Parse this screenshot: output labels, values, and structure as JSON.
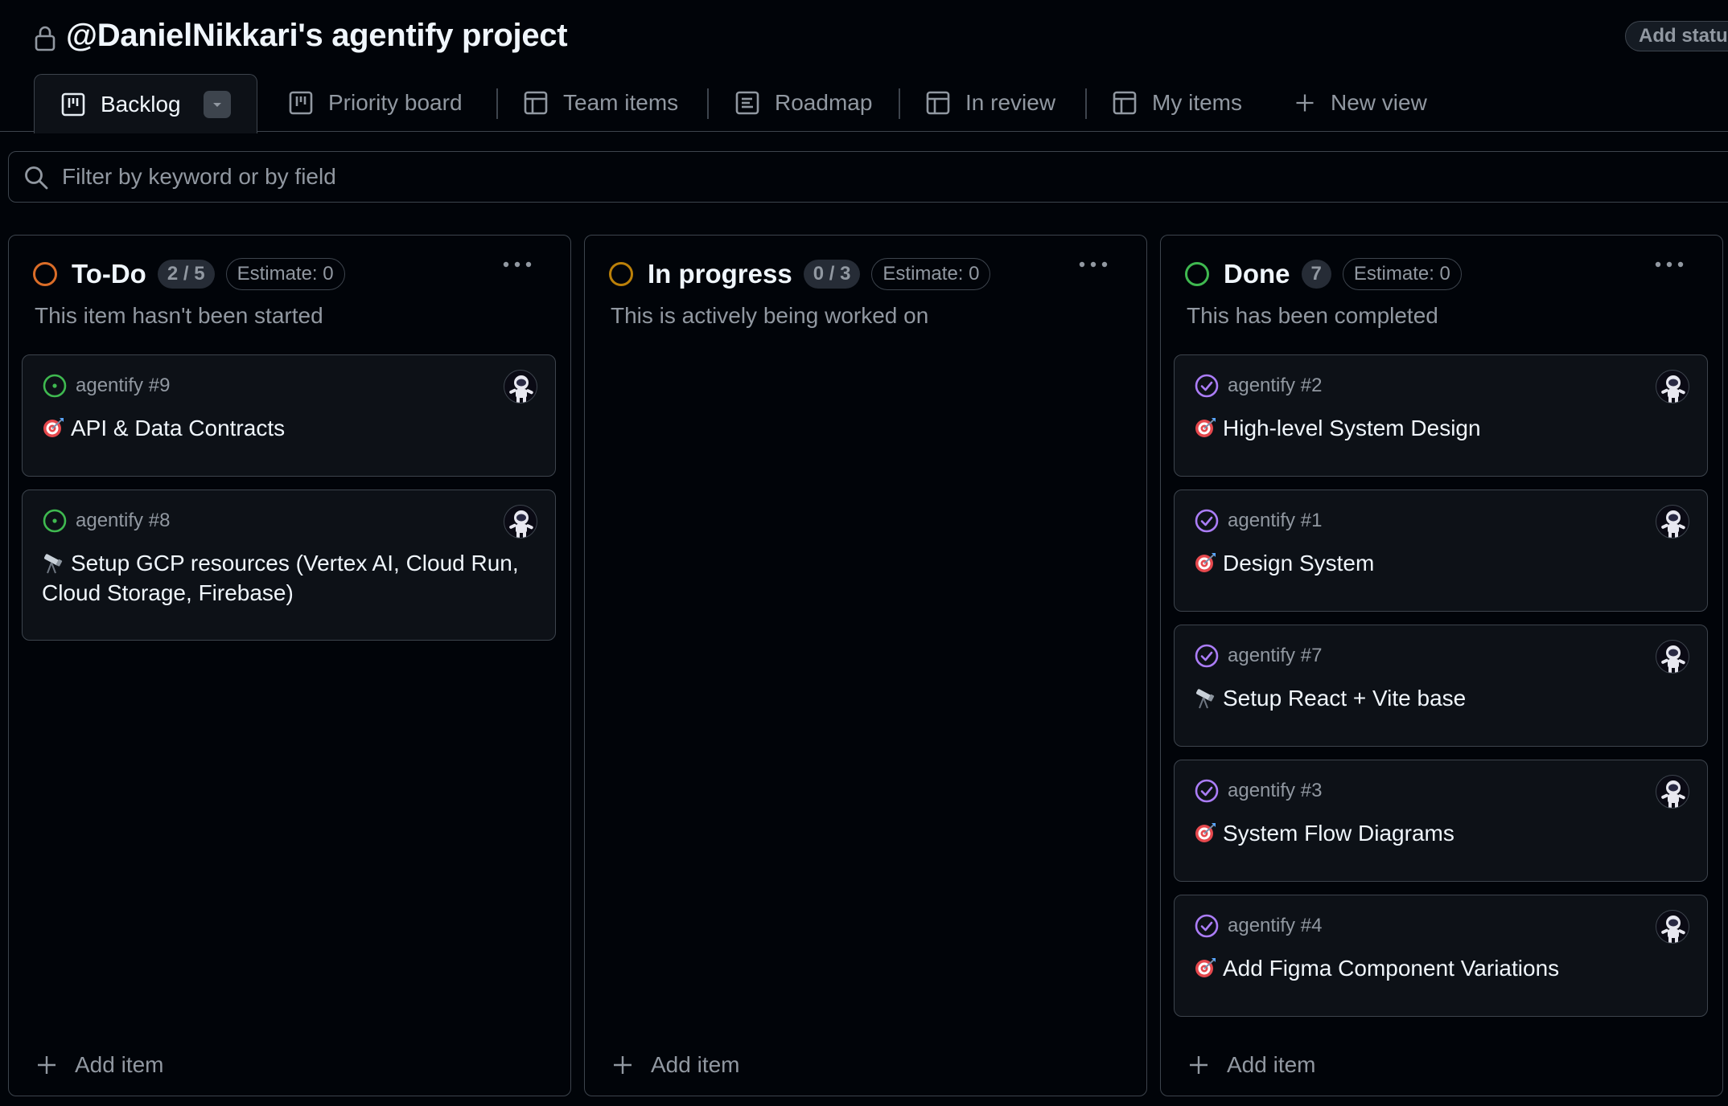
{
  "header": {
    "title": "@DanielNikkari's agentify project",
    "add_status_label": "Add statu"
  },
  "tabs": [
    {
      "label": "Backlog",
      "icon": "board-icon",
      "active": true
    },
    {
      "label": "Priority board",
      "icon": "board-icon"
    },
    {
      "label": "Team items",
      "icon": "table-icon"
    },
    {
      "label": "Roadmap",
      "icon": "roadmap-icon"
    },
    {
      "label": "In review",
      "icon": "table-icon"
    },
    {
      "label": "My items",
      "icon": "table-icon"
    },
    {
      "label": "New view",
      "icon": "plus-icon"
    }
  ],
  "filter": {
    "placeholder": "Filter by keyword or by field"
  },
  "colors": {
    "todo": "#db6d28",
    "in_progress": "#bb8009",
    "done": "#3fb950",
    "open_issue": "#3fb950",
    "closed_issue": "#ab7df8"
  },
  "columns": [
    {
      "title": "To-Do",
      "count": "2 / 5",
      "estimate": "Estimate: 0",
      "description": "This item hasn't been started",
      "add_item": "Add item",
      "cards": [
        {
          "ref": "agentify #9",
          "emoji": "target",
          "title": "API & Data Contracts",
          "state": "open"
        },
        {
          "ref": "agentify #8",
          "emoji": "telescope",
          "title": "Setup GCP resources (Vertex AI, Cloud Run, Cloud Storage, Firebase)",
          "state": "open"
        }
      ]
    },
    {
      "title": "In progress",
      "count": "0 / 3",
      "estimate": "Estimate: 0",
      "description": "This is actively being worked on",
      "add_item": "Add item",
      "cards": []
    },
    {
      "title": "Done",
      "count": "7",
      "estimate": "Estimate: 0",
      "description": "This has been completed",
      "add_item": "Add item",
      "cards": [
        {
          "ref": "agentify #2",
          "emoji": "target",
          "title": "High-level System Design",
          "state": "closed"
        },
        {
          "ref": "agentify #1",
          "emoji": "target",
          "title": "Design System",
          "state": "closed"
        },
        {
          "ref": "agentify #7",
          "emoji": "telescope",
          "title": "Setup React + Vite base",
          "state": "closed"
        },
        {
          "ref": "agentify #3",
          "emoji": "target",
          "title": "System Flow Diagrams",
          "state": "closed"
        },
        {
          "ref": "agentify #4",
          "emoji": "target",
          "title": "Add Figma Component Variations",
          "state": "closed"
        }
      ]
    }
  ]
}
